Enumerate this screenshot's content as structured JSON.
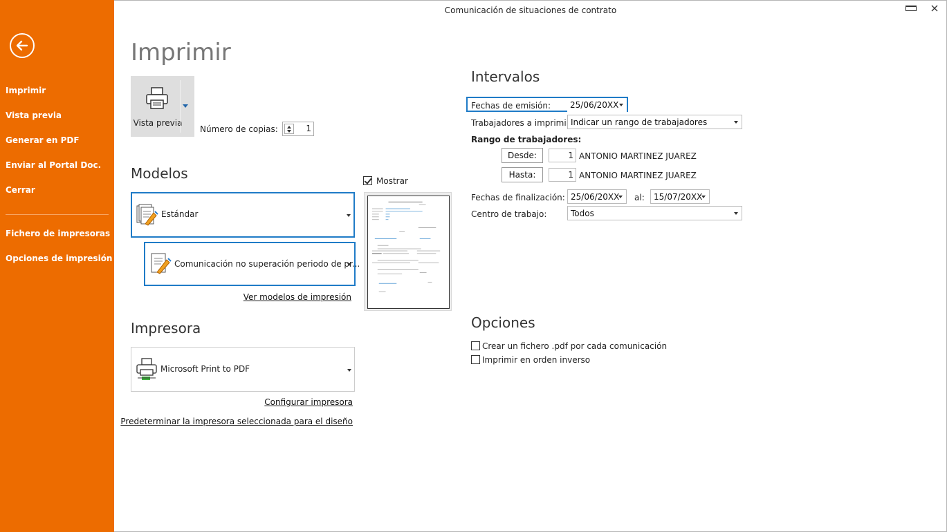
{
  "window": {
    "title": "Comunicación de situaciones de contrato"
  },
  "sidebar": {
    "items": [
      {
        "label": "Imprimir"
      },
      {
        "label": "Vista previa"
      },
      {
        "label": "Generar en PDF"
      },
      {
        "label": "Enviar al Portal Doc."
      },
      {
        "label": "Cerrar"
      }
    ],
    "items2": [
      {
        "label": "Fichero de impresoras"
      },
      {
        "label": "Opciones de impresión"
      }
    ]
  },
  "main": {
    "title": "Imprimir",
    "preview_button": "Vista previa",
    "copies_label": "Número de copias:",
    "copies_value": "1",
    "models_heading": "Modelos",
    "model_primary": "Estándar",
    "model_secondary": "Comunicación no superación periodo de pr...",
    "show_label": "Mostrar",
    "view_models_link": "Ver modelos de impresión",
    "printer_heading": "Impresora",
    "printer_value": "Microsoft Print to PDF",
    "configure_printer_link": "Configurar impresora",
    "default_printer_link": "Predeterminar la impresora seleccionada para el diseño"
  },
  "intervals": {
    "heading": "Intervalos",
    "issue_dates_label": "Fechas de emisión:",
    "issue_date": "25/06/20XX",
    "workers_label": "Trabajadores a imprimir:",
    "workers_value": "Indicar un rango de trabajadores",
    "range_label": "Rango de trabajadores:",
    "from_button": "Desde:",
    "from_value": "1",
    "from_name": "ANTONIO MARTINEZ JUAREZ",
    "to_button": "Hasta:",
    "to_value": "1",
    "to_name": "ANTONIO MARTINEZ JUAREZ",
    "end_dates_label": "Fechas de finalización:",
    "end_from": "25/06/20XX",
    "al_label": "al:",
    "end_to": "15/07/20XX",
    "workplace_label": "Centro de trabajo:",
    "workplace_value": "Todos"
  },
  "options": {
    "heading": "Opciones",
    "pdf_each": "Crear un fichero .pdf por cada comunicación",
    "reverse_order": "Imprimir en orden inverso"
  },
  "colors": {
    "sidebar": "#ed6c00",
    "accent": "#1f7bc7"
  }
}
